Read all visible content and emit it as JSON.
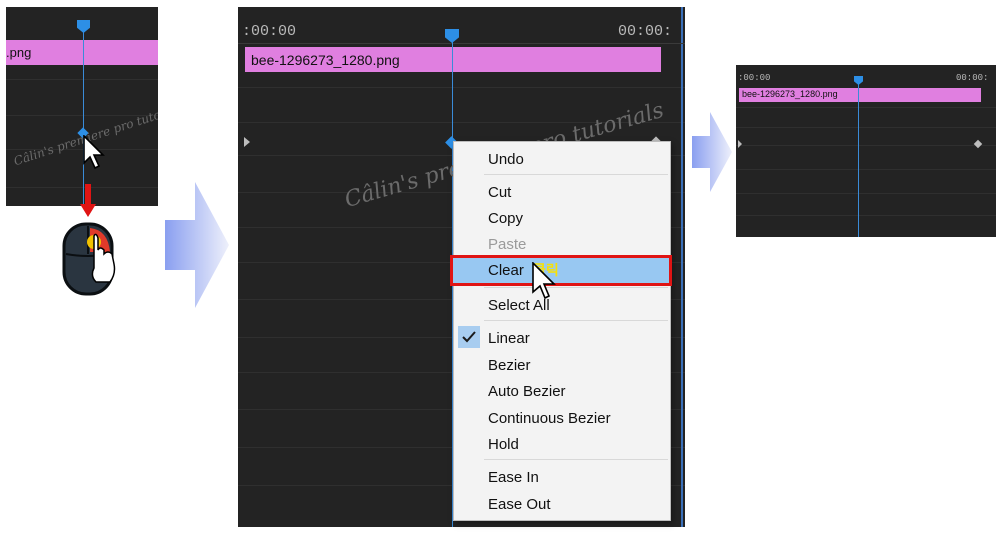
{
  "panel_left": {
    "clip_name": ".png",
    "watermark": "Câlin's premiere pro tutorials"
  },
  "panel_main": {
    "timecode_left": ":00:00",
    "timecode_right": "00:00:",
    "clip_name": "bee-1296273_1280.png",
    "watermark": "Câlin's premiere pro tutorials"
  },
  "context_menu": {
    "items": [
      {
        "label": "Undo",
        "enabled": true
      },
      {
        "label": "Cut",
        "enabled": true
      },
      {
        "label": "Copy",
        "enabled": true
      },
      {
        "label": "Paste",
        "enabled": false
      },
      {
        "label": "Clear",
        "enabled": true,
        "highlighted": true
      },
      {
        "label": "Select All",
        "enabled": true
      },
      {
        "label": "Linear",
        "enabled": true,
        "checked": true
      },
      {
        "label": "Bezier",
        "enabled": true
      },
      {
        "label": "Auto Bezier",
        "enabled": true
      },
      {
        "label": "Continuous Bezier",
        "enabled": true
      },
      {
        "label": "Hold",
        "enabled": true
      },
      {
        "label": "Ease In",
        "enabled": true
      },
      {
        "label": "Ease Out",
        "enabled": true
      }
    ],
    "click_annotation": "클릭"
  },
  "panel_right": {
    "timecode_left": ":00:00",
    "timecode_right": "00:00:",
    "clip_name": "bee-1296273_1280.png"
  },
  "colors": {
    "panel_bg": "#232323",
    "clip": "#e07fe0",
    "playhead": "#2d8fe6",
    "highlight": "#98c8f2",
    "highlight_border": "#e01414"
  },
  "icons": [
    "mouse-pointer-icon",
    "mouse-right-click-icon",
    "red-arrow-down-icon",
    "flow-arrow-icon",
    "checkmark-icon"
  ]
}
